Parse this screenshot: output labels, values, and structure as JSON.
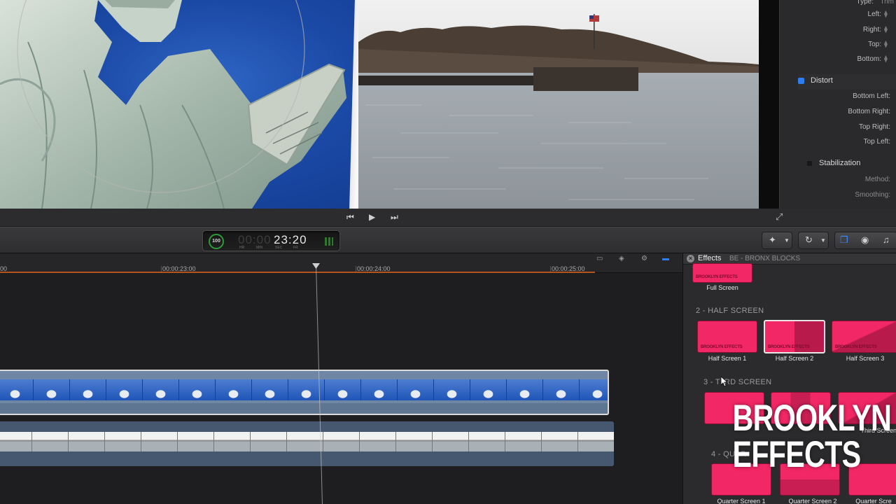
{
  "inspector": {
    "rows_top": [
      {
        "label": "Type:",
        "value": "Trim"
      },
      {
        "label": "Left:"
      },
      {
        "label": "Right:"
      },
      {
        "label": "Top:"
      },
      {
        "label": "Bottom:"
      }
    ],
    "distort_label": "Distort",
    "distort_rows": [
      "Bottom Left:",
      "Bottom Right:",
      "Top Right:",
      "Top Left:"
    ],
    "stabilization_label": "Stabilization",
    "stab_rows": [
      "Method:",
      "Smoothing:"
    ]
  },
  "timecode": {
    "percent": "100",
    "dim": "00:00",
    "value": "23:20",
    "units": [
      "HR",
      "MIN",
      "SEC",
      "FR"
    ]
  },
  "ruler": {
    "labels": [
      "00",
      "00:00:23:00",
      "00:00:24:00",
      "00:00:25:00"
    ]
  },
  "effects": {
    "title": "Effects",
    "breadcrumb": "BE - BRONX BLOCKS",
    "sections": [
      "2 - HALF SCREEN",
      "3 - THIRD SCREEN",
      "4 - QUARTER SCREEN"
    ],
    "third_section_visible": "3 - T",
    "third_section_tail": "RD SCREEN",
    "fourth_section_visible": "4 - QUAR",
    "full_screen_label": "Full Screen",
    "half_labels": [
      "Half Screen 1",
      "Half Screen 2",
      "Half Screen 3"
    ],
    "third_labels": [
      "Third Screen 3"
    ],
    "quarter_labels": [
      "Quarter Screen 1",
      "Quarter Screen 2",
      "Quarter Scre"
    ],
    "watermark": "BROOKLYN EFFECTS"
  },
  "logo": {
    "line1": "BROOKLYN",
    "line2": "EFFECTS"
  },
  "colors": {
    "accent": "#2d7cf0",
    "effect_pink": "#f22765",
    "ruler_range": "#b3541e",
    "timecode_ring": "#2e9b3a"
  }
}
